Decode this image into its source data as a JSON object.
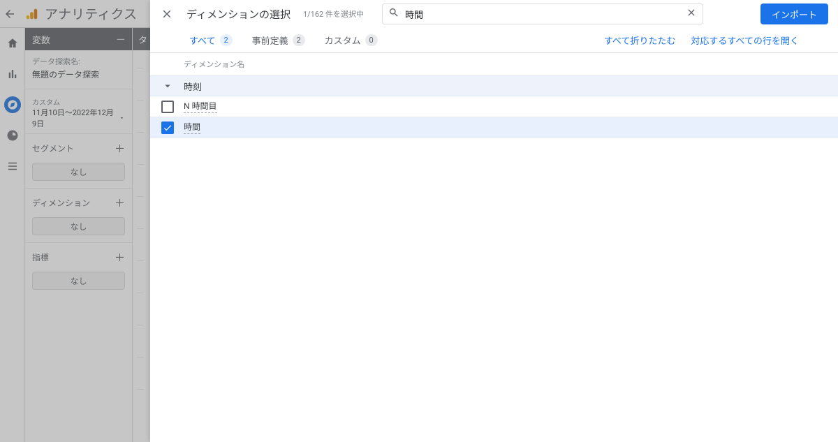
{
  "app": {
    "name": "アナリティクス"
  },
  "variables_panel": {
    "header": "変数",
    "explore_name_label": "データ探索名:",
    "explore_name": "無題のデータ探索",
    "date_label": "カスタム",
    "date_range": "11月10日～2022年12月9日",
    "segment_label": "セグメント",
    "dimension_label": "ディメンション",
    "metric_label": "指標",
    "none_chip": "なし"
  },
  "tab_settings_stub": "タ",
  "modal": {
    "title": "ディメンションの選択",
    "selection_count": "1/162 件を選択中",
    "search": {
      "placeholder": "",
      "value": "時間"
    },
    "import_btn": "インポート",
    "tabs": [
      {
        "key": "all",
        "label": "すべて",
        "count": 2,
        "active": true
      },
      {
        "key": "predefined",
        "label": "事前定義",
        "count": 2,
        "active": false
      },
      {
        "key": "custom",
        "label": "カスタム",
        "count": 0,
        "active": false
      }
    ],
    "collapse_all": "すべて折りたたむ",
    "expand_matching": "対応するすべての行を開く",
    "col_header": "ディメンション名",
    "group": {
      "label": "時刻",
      "expanded": true
    },
    "items": [
      {
        "label": "N 時間目",
        "checked": false
      },
      {
        "label": "時間",
        "checked": true
      }
    ]
  }
}
